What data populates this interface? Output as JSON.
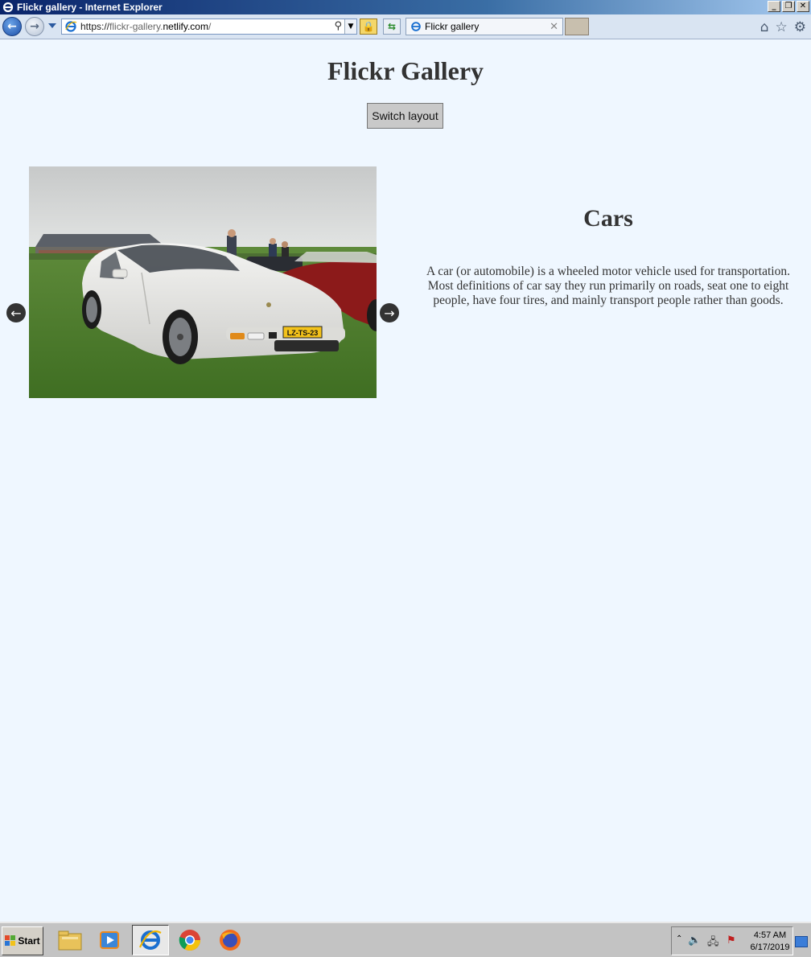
{
  "window": {
    "title": "Flickr gallery - Internet Explorer",
    "controls": [
      "_",
      "❐",
      "✕"
    ]
  },
  "browser": {
    "address": {
      "scheme": "https://",
      "subdomain": "flickr-gallery.",
      "domain": "netlify.com",
      "path": "/"
    },
    "tab_title": "Flickr gallery"
  },
  "page": {
    "title": "Flickr Gallery",
    "switch_button": "Switch layout",
    "prev_arrow": "←",
    "next_arrow": "→",
    "photo": {
      "subject": "white sports car on grass",
      "plate": "LZ-TS-23"
    },
    "info": {
      "title": "Cars",
      "description": "A car (or automobile) is a wheeled motor vehicle used for transportation. Most definitions of car say they run primarily on roads, seat one to eight people, have four tires, and mainly transport people rather than goods."
    }
  },
  "taskbar": {
    "start_label": "Start",
    "apps": [
      "file-explorer",
      "media-player",
      "internet-explorer",
      "chrome",
      "firefox"
    ],
    "clock": {
      "time": "4:57 AM",
      "date": "6/17/2019"
    }
  }
}
